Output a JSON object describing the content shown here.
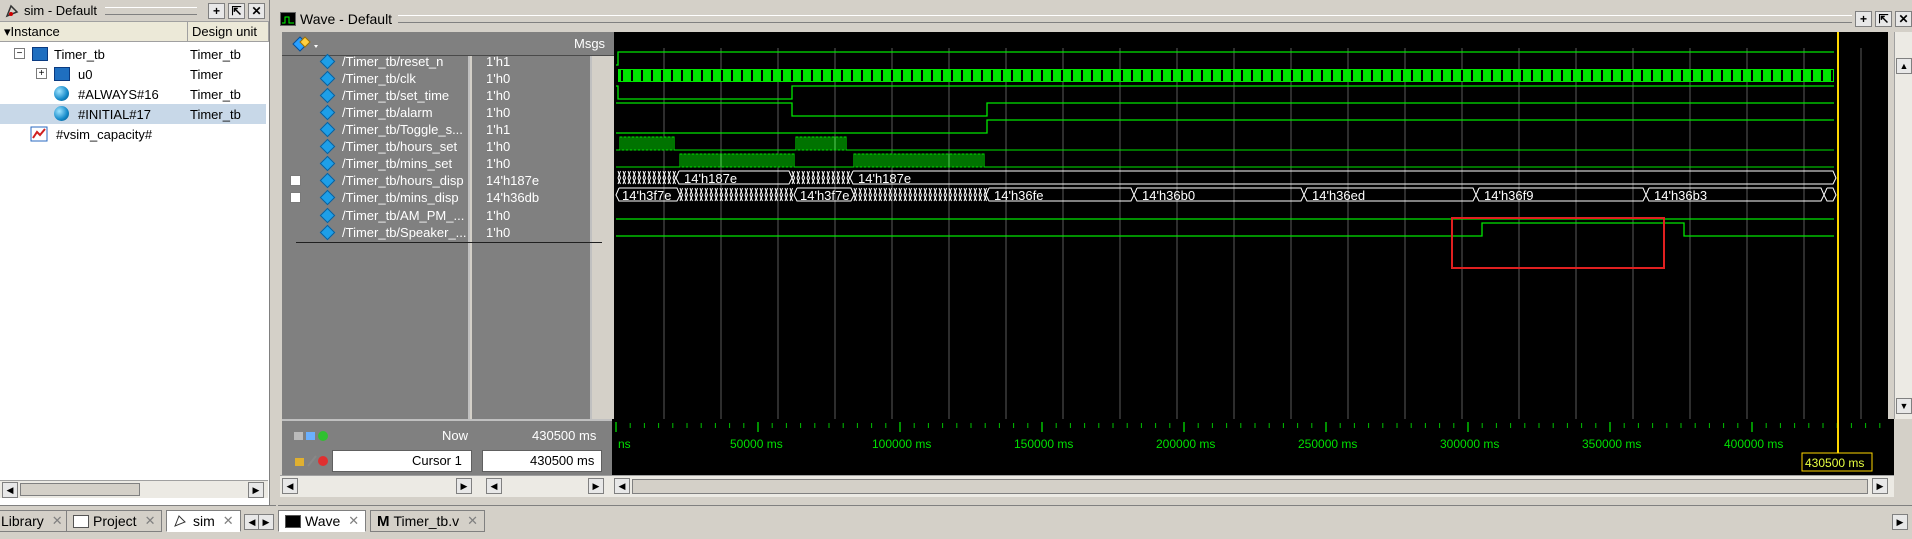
{
  "sim_panel": {
    "title": "sim - Default",
    "columns": {
      "instance": "Instance",
      "design_unit": "Design unit"
    },
    "rows": [
      {
        "name": "Timer_tb",
        "unit": "Timer_tb"
      },
      {
        "name": "u0",
        "unit": "Timer"
      },
      {
        "name": "#ALWAYS#16",
        "unit": "Timer_tb"
      },
      {
        "name": "#INITIAL#17",
        "unit": "Timer_tb"
      },
      {
        "name": "#vsim_capacity#",
        "unit": ""
      }
    ],
    "tabs": [
      {
        "label": "Library"
      },
      {
        "label": "Project"
      },
      {
        "label": "sim"
      }
    ]
  },
  "wave": {
    "title": "Wave - Default",
    "msgs_label": "Msgs",
    "signals": [
      {
        "name": "/Timer_tb/reset_n",
        "value": "1'h1"
      },
      {
        "name": "/Timer_tb/clk",
        "value": "1'h0"
      },
      {
        "name": "/Timer_tb/set_time",
        "value": "1'h0"
      },
      {
        "name": "/Timer_tb/alarm",
        "value": "1'h0"
      },
      {
        "name": "/Timer_tb/Toggle_s...",
        "value": "1'h1"
      },
      {
        "name": "/Timer_tb/hours_set",
        "value": "1'h0"
      },
      {
        "name": "/Timer_tb/mins_set",
        "value": "1'h0"
      },
      {
        "name": "/Timer_tb/hours_disp",
        "value": "14'h187e"
      },
      {
        "name": "/Timer_tb/mins_disp",
        "value": "14'h36db"
      },
      {
        "name": "/Timer_tb/AM_PM_...",
        "value": "1'h0"
      },
      {
        "name": "/Timer_tb/Speaker_...",
        "value": "1'h0"
      }
    ],
    "bus_labels": {
      "hours_disp": [
        "14'h187e",
        "14'h187e"
      ],
      "mins_disp": [
        "14'h3f7e",
        "14'h3f7e",
        "14'h36fe",
        "14'h36b0",
        "14'h36ed",
        "14'h36f9",
        "14'h36b3"
      ]
    },
    "now_label": "Now",
    "now_value": "430500 ms",
    "cursor_label": "Cursor 1",
    "cursor_value": "430500 ms",
    "cursor_readout": "430500 ms",
    "timeline_ticks": [
      "ns",
      "50000 ms",
      "100000 ms",
      "150000 ms",
      "200000 ms",
      "250000 ms",
      "300000 ms",
      "350000 ms",
      "400000 ms"
    ],
    "tabs": [
      {
        "label": "Wave"
      },
      {
        "label": "Timer_tb.v"
      }
    ]
  },
  "colors": {
    "wave": "#00e600",
    "cursor": "#ffd700",
    "highlight": "#e02020"
  }
}
